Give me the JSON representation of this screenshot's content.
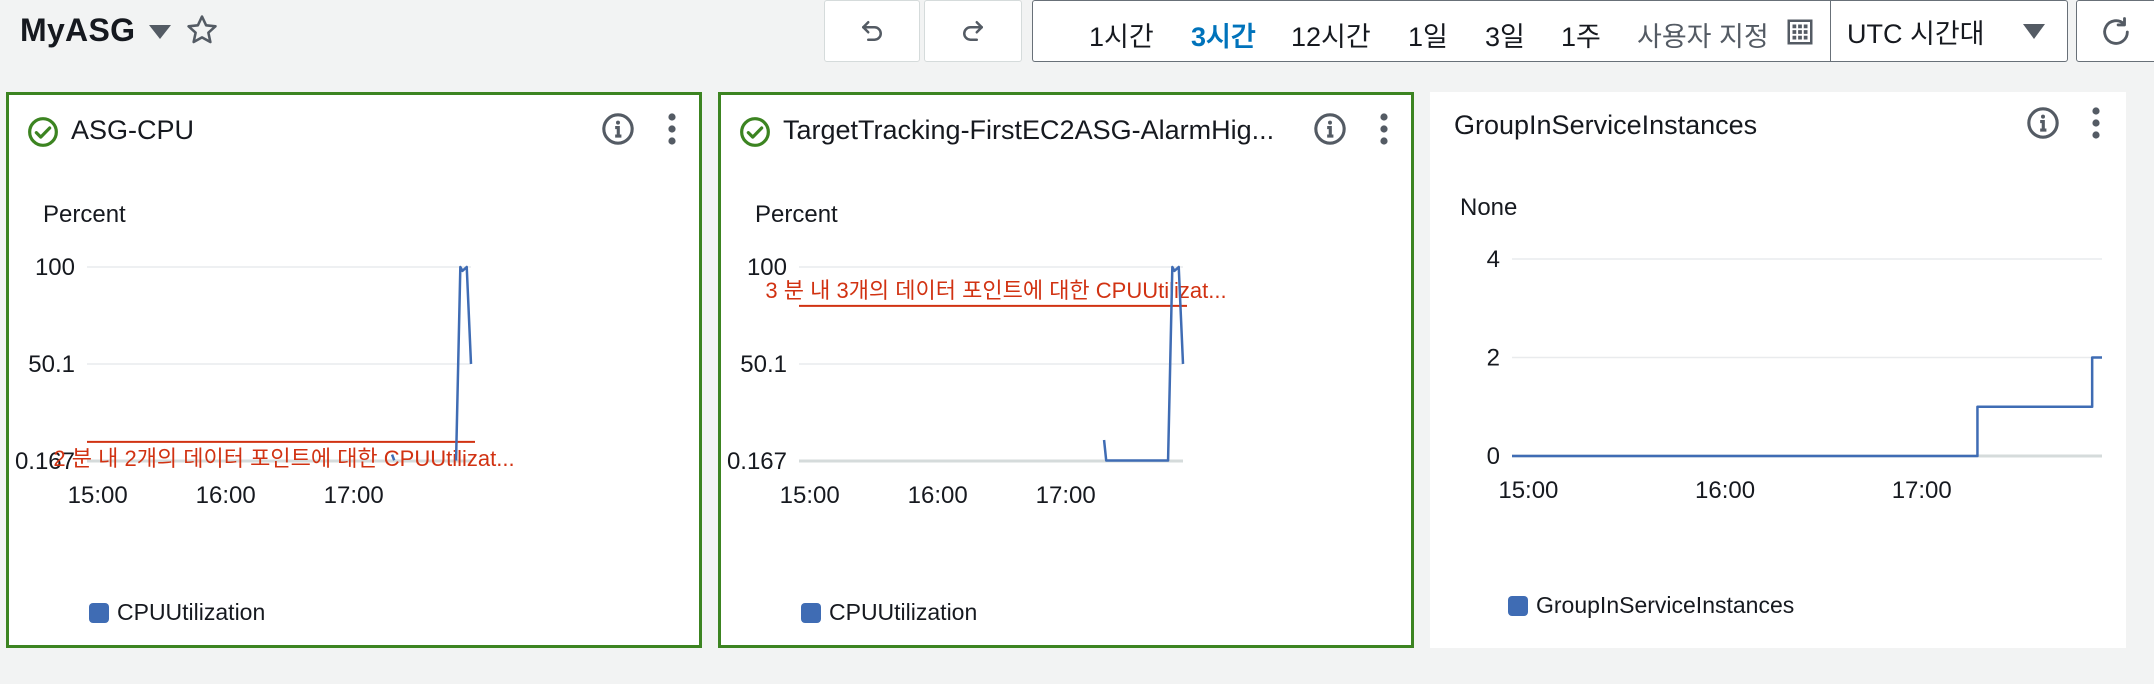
{
  "header": {
    "dashboard_name": "MyASG",
    "undo_icon": "undo-icon",
    "redo_icon": "redo-icon",
    "time_ranges": [
      {
        "label": "1시간",
        "active": false
      },
      {
        "label": "3시간",
        "active": true
      },
      {
        "label": "12시간",
        "active": false
      },
      {
        "label": "1일",
        "active": false
      },
      {
        "label": "3일",
        "active": false
      },
      {
        "label": "1주",
        "active": false
      }
    ],
    "custom_label": "사용자 지정",
    "timezone": "UTC 시간대"
  },
  "widgets": [
    {
      "title": "ASG-CPU",
      "alarm_state": "ok",
      "unit": "Percent",
      "y_ticks": [
        "100",
        "50.1",
        "0.167"
      ],
      "x_ticks": [
        "15:00",
        "16:00",
        "17:00"
      ],
      "legend": "CPUUtilization",
      "annotation": "2 분 내 2개의 데이터 포인트에 대한 CPUUtilizat..."
    },
    {
      "title": "TargetTracking-FirstEC2ASG-AlarmHig...",
      "alarm_state": "ok",
      "unit": "Percent",
      "y_ticks": [
        "100",
        "50.1",
        "0.167"
      ],
      "x_ticks": [
        "15:00",
        "16:00",
        "17:00"
      ],
      "legend": "CPUUtilization",
      "annotation": "3 분 내 3개의 데이터 포인트에 대한 CPUUtilizat..."
    },
    {
      "title": "GroupInServiceInstances",
      "alarm_state": "none",
      "unit": "None",
      "y_ticks": [
        "4",
        "2",
        "0"
      ],
      "x_ticks": [
        "15:00",
        "16:00",
        "17:00"
      ],
      "legend": "GroupInServiceInstances",
      "annotation": ""
    }
  ],
  "chart_data": [
    {
      "type": "line",
      "unit": "Percent",
      "ylim": [
        0.167,
        100
      ],
      "x_range": [
        "14:55",
        "17:55"
      ],
      "series": [
        {
          "name": "CPUUtilization",
          "color": "#3f6cb4",
          "x": [
            "17:18",
            "17:19"
          ],
          "y": [
            3.5,
            0.5
          ]
        },
        {
          "name": "CPUUtilization",
          "color": "#3f6cb4",
          "x": [
            "17:48",
            "17:50",
            "17:51",
            "17:52",
            "17:53",
            "17:54",
            "17:55"
          ],
          "y": [
            0.4,
            100,
            98,
            99,
            100,
            75,
            50.1
          ]
        }
      ],
      "threshold": {
        "value": 10,
        "color": "#d13212"
      }
    },
    {
      "type": "line",
      "unit": "Percent",
      "ylim": [
        0.167,
        100
      ],
      "x_range": [
        "14:55",
        "17:55"
      ],
      "series": [
        {
          "name": "CPUUtilization",
          "color": "#3f6cb4",
          "x": [
            "17:18",
            "17:19",
            "17:48",
            "17:50",
            "17:51",
            "17:52",
            "17:53",
            "17:54",
            "17:55"
          ],
          "y": [
            11,
            0.4,
            0.4,
            100,
            98,
            99,
            100,
            75,
            50.1
          ]
        }
      ],
      "threshold": {
        "value": 80,
        "color": "#d13212"
      }
    },
    {
      "type": "line",
      "unit": "None",
      "ylim": [
        0,
        4
      ],
      "x_range": [
        "14:55",
        "17:55"
      ],
      "series": [
        {
          "name": "GroupInServiceInstances",
          "color": "#3f6cb4",
          "x": [
            "14:55",
            "17:17",
            "17:17",
            "17:52",
            "17:52",
            "17:55"
          ],
          "y": [
            0,
            0,
            1,
            1,
            2,
            2
          ]
        }
      ]
    }
  ]
}
